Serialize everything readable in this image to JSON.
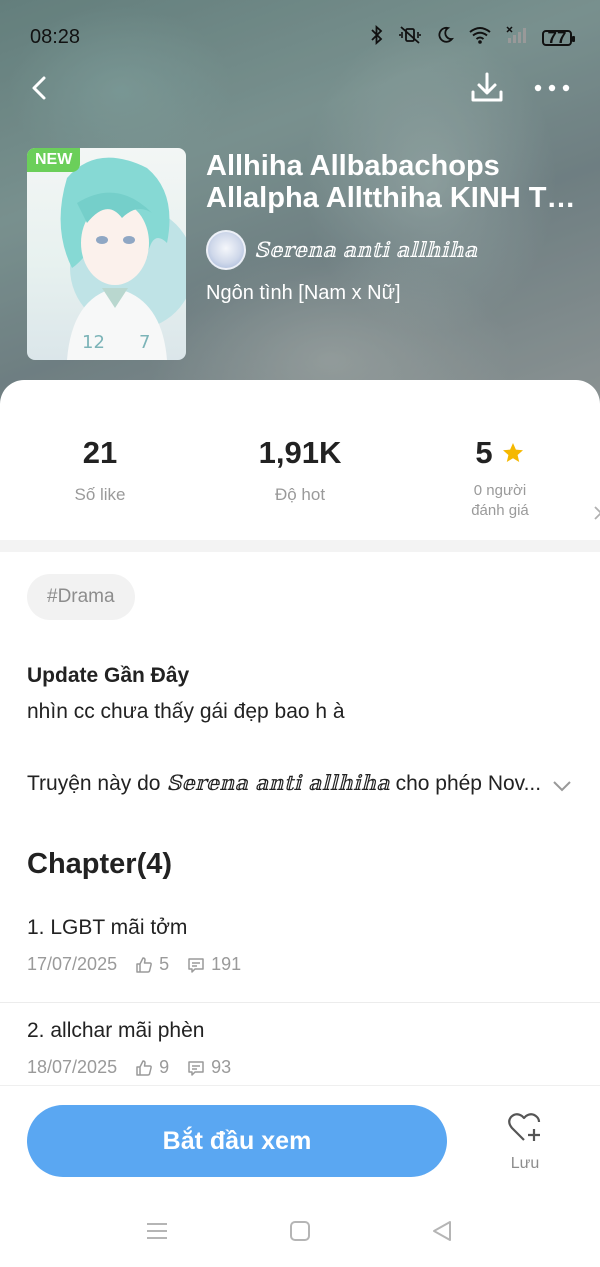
{
  "status_bar": {
    "time": "08:28",
    "battery": "77",
    "icons": [
      "bluetooth-icon",
      "mute-vibrate-icon",
      "moon-icon",
      "wifi-icon",
      "signal-icon",
      "battery-icon"
    ]
  },
  "header": {
    "badge": "NEW",
    "title_line1": "Allhiha Allbabachops",
    "title_line2": "Allalpha Alltthiha KINH TỞM",
    "author": "𝕊𝕖𝕣𝕖𝕟𝕒 𝕒𝕟𝕥𝕚 𝕒𝕝𝕝𝕙𝕚𝕙𝕒",
    "genre": "Ngôn tình [Nam x Nữ]"
  },
  "stats": {
    "likes_value": "21",
    "likes_label": "Số like",
    "hot_value": "1,91K",
    "hot_label": "Độ hot",
    "rating_value": "5",
    "rating_label_1": "0 người",
    "rating_label_2": "đánh giá"
  },
  "tags": [
    "#Drama"
  ],
  "update": {
    "title": "Update Gần Đây",
    "text": "nhìn cc chưa thấy gái đẹp bao h à"
  },
  "description": {
    "prefix": "Truyện này do ",
    "author": "𝕊𝕖𝕣𝕖𝕟𝕒 𝕒𝕟𝕥𝕚 𝕒𝕝𝕝𝕙𝕚𝕙𝕒",
    "suffix": " cho phép Nov..."
  },
  "chapters": {
    "heading": "Chapter(4)",
    "items": [
      {
        "title": "1. LGBT mãi tởm",
        "date": "17/07/2025",
        "likes": "5",
        "comments": "191"
      },
      {
        "title": "2. allchar mãi phèn",
        "date": "18/07/2025",
        "likes": "9",
        "comments": "93"
      }
    ]
  },
  "bottom": {
    "start_label": "Bắt đầu xem",
    "save_label": "Lưu"
  },
  "colors": {
    "accent": "#5aa7f2",
    "new_badge": "#6bcf5a",
    "star": "#f5b800"
  }
}
